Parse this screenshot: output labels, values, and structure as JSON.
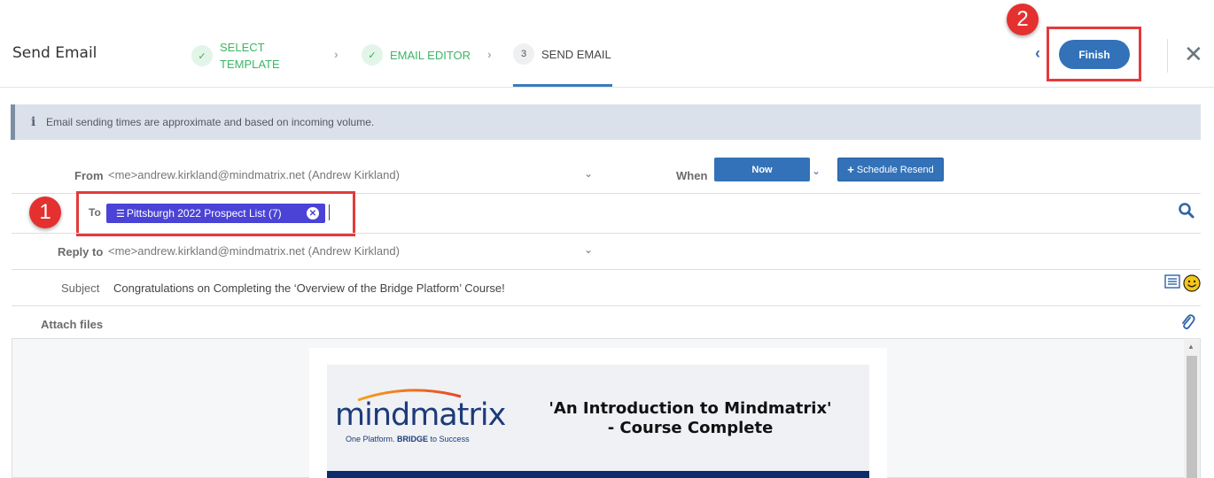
{
  "header": {
    "title": "Send Email",
    "steps": [
      {
        "line1": "SELECT",
        "line2": "TEMPLATE",
        "state": "done",
        "marker": "✓"
      },
      {
        "label": "EMAIL EDITOR",
        "state": "done",
        "marker": "✓"
      },
      {
        "label": "SEND EMAIL",
        "state": "current",
        "marker": "3"
      }
    ],
    "finish_label": "Finish"
  },
  "annotations": {
    "badge1": "1",
    "badge2": "2"
  },
  "notice": {
    "text": "Email sending times are approximate and based on incoming volume."
  },
  "form": {
    "from_label": "From",
    "from_value": "<me>andrew.kirkland@mindmatrix.net (Andrew Kirkland)",
    "when_label": "When",
    "now_label": "Now",
    "schedule_label": "Schedule Resend",
    "to_label": "To",
    "to_chip": "Pittsburgh 2022 Prospect List (7)",
    "reply_label": "Reply to",
    "reply_value": "<me>andrew.kirkland@mindmatrix.net (Andrew Kirkland)",
    "subject_label": "Subject",
    "subject_value": "Congratulations on Completing the ‘Overview of the Bridge Platform’ Course!",
    "attach_label": "Attach files"
  },
  "email_preview": {
    "logo_text": "mindmatrix",
    "logo_tagline_a": "One Platform. ",
    "logo_tagline_b": "BRIDGE",
    "logo_tagline_c": " to Success",
    "heading_line1": "'An Introduction to Mindmatrix'",
    "heading_line2": "- Course Complete"
  },
  "colors": {
    "accent": "#3372b8",
    "chip": "#4a43d6",
    "done": "#3cb664",
    "annotation": "#e23b3b"
  },
  "icons": [
    "check-icon",
    "chevron-right-icon",
    "chevron-left-icon",
    "close-icon",
    "info-icon",
    "chevron-down-icon",
    "plus-icon",
    "list-icon",
    "remove-icon",
    "search-icon",
    "smiley-icon",
    "paperclip-icon"
  ]
}
